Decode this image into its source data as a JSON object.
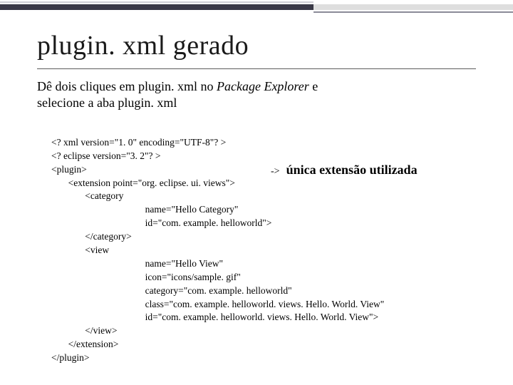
{
  "title": "plugin. xml gerado",
  "intro": {
    "line1a": "Dê dois cliques em plugin. xml no ",
    "pkg": "Package Explorer",
    "line1b": " e",
    "line2": "selecione a aba  plugin. xml"
  },
  "annotation": {
    "arrow": "->",
    "label": "única extensão utilizada"
  },
  "code": {
    "l01": "<? xml version=\"1. 0\" encoding=\"UTF-8\"? >",
    "l02": "<? eclipse version=\"3. 2\"? >",
    "l03": "<plugin>",
    "l04": "       <extension point=\"org. eclipse. ui. views\">",
    "l05": "              <category",
    "l06": "                                       name=\"Hello Category\"",
    "l07": "                                       id=\"com. example. helloworld\">",
    "l08": "              </category>",
    "l09": "              <view",
    "l10": "                                       name=\"Hello View\"",
    "l11": "                                       icon=\"icons/sample. gif\"",
    "l12": "                                       category=\"com. example. helloworld\"",
    "l13": "                                       class=\"com. example. helloworld. views. Hello. World. View\"",
    "l14": "                                       id=\"com. example. helloworld. views. Hello. World. View\">",
    "l15": "              </view>",
    "l16": "       </extension>",
    "l17": "</plugin>"
  }
}
